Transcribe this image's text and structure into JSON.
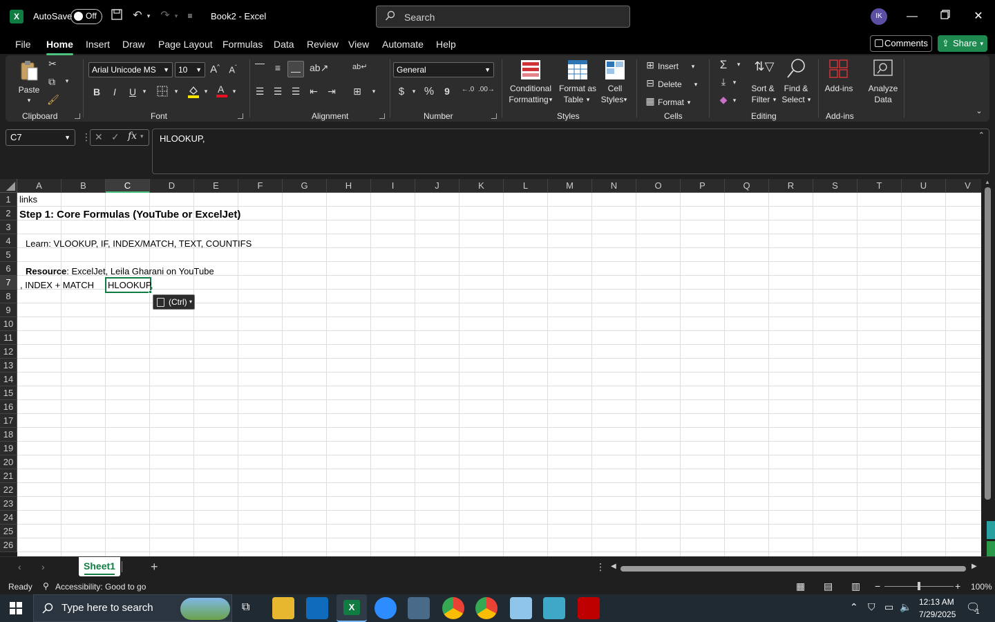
{
  "titlebar": {
    "autosave_label": "AutoSave",
    "autosave_state": "Off",
    "doc_title": "Book2  -  Excel",
    "search_placeholder": "Search",
    "avatar_initials": "IK"
  },
  "menu": {
    "tabs": [
      "File",
      "Home",
      "Insert",
      "Draw",
      "Page Layout",
      "Formulas",
      "Data",
      "Review",
      "View",
      "Automate",
      "Help"
    ],
    "active": "Home",
    "comments": "Comments",
    "share": "Share"
  },
  "ribbon": {
    "clipboard": {
      "paste": "Paste",
      "label": "Clipboard"
    },
    "font": {
      "name": "Arial Unicode MS",
      "size": "10",
      "label": "Font",
      "bold": "B",
      "italic": "I",
      "underline": "U"
    },
    "alignment": {
      "label": "Alignment"
    },
    "number": {
      "format": "General",
      "label": "Number",
      "currency": "$",
      "percent": "%",
      "comma": "9"
    },
    "styles": {
      "conditional_1": "Conditional",
      "conditional_2": "Formatting",
      "format_table_1": "Format as",
      "format_table_2": "Table",
      "cell_styles_1": "Cell",
      "cell_styles_2": "Styles",
      "label": "Styles"
    },
    "cells": {
      "insert": "Insert",
      "delete": "Delete",
      "format": "Format",
      "label": "Cells"
    },
    "editing": {
      "sort_1": "Sort &",
      "sort_2": "Filter",
      "find_1": "Find &",
      "find_2": "Select",
      "label": "Editing"
    },
    "addins": {
      "addins": "Add-ins",
      "analyze_1": "Analyze",
      "analyze_2": "Data",
      "label": "Add-ins"
    }
  },
  "formula_bar": {
    "name_box": "C7",
    "fx": "fx",
    "content": "HLOOKUP,"
  },
  "grid": {
    "columns": [
      "A",
      "B",
      "C",
      "D",
      "E",
      "F",
      "G",
      "H",
      "I",
      "J",
      "K",
      "L",
      "M",
      "N",
      "O",
      "P",
      "Q",
      "R",
      "S",
      "T",
      "U",
      "V"
    ],
    "selected_column": "C",
    "rows": [
      "1",
      "2",
      "3",
      "4",
      "5",
      "6",
      "7",
      "8",
      "9",
      "10",
      "11",
      "12",
      "13",
      "14",
      "15",
      "16",
      "17",
      "18",
      "19",
      "20",
      "21",
      "22",
      "23",
      "24",
      "25",
      "26"
    ],
    "selected_row": "7",
    "cells": {
      "A1": "links",
      "A2": "Step 1: Core Formulas (YouTube or ExcelJet)",
      "A4": "Learn: VLOOKUP, IF, INDEX/MATCH, TEXT, COUNTIFS",
      "A6_bold": "Resource",
      "A6_rest": ": ExcelJet, Leila Gharani on YouTube",
      "A7": ", INDEX + MATCH",
      "C7": "HLOOKUP,"
    },
    "paste_options": "(Ctrl)"
  },
  "sheets": {
    "tabs": [
      "Sheet1"
    ],
    "add": "+"
  },
  "status": {
    "ready": "Ready",
    "accessibility": "Accessibility: Good to go",
    "zoom": "100%",
    "zoom_fraction": 0.5
  },
  "taskbar": {
    "search_placeholder": "Type here to search",
    "time": "12:13 AM",
    "date": "7/29/2025",
    "notification_count": "1"
  }
}
